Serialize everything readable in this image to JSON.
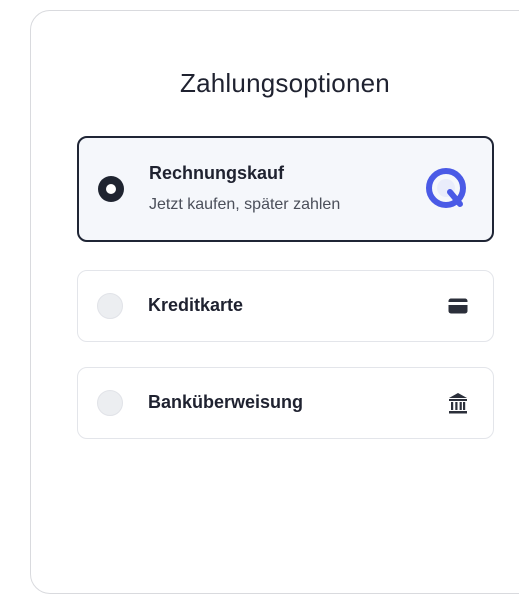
{
  "heading": "Zahlungsoptionen",
  "options": [
    {
      "label": "Rechnungskauf",
      "sublabel": "Jetzt kaufen, später zahlen",
      "selected": true,
      "icon": "invoice-brand-icon"
    },
    {
      "label": "Kreditkarte",
      "selected": false,
      "icon": "credit-card-icon"
    },
    {
      "label": "Banküberweisung",
      "selected": false,
      "icon": "bank-icon"
    }
  ],
  "colors": {
    "text": "#1f2230",
    "selected_border": "#1f2535",
    "selected_bg": "#f5f7fb",
    "brand_icon": "#4a5ae6"
  }
}
